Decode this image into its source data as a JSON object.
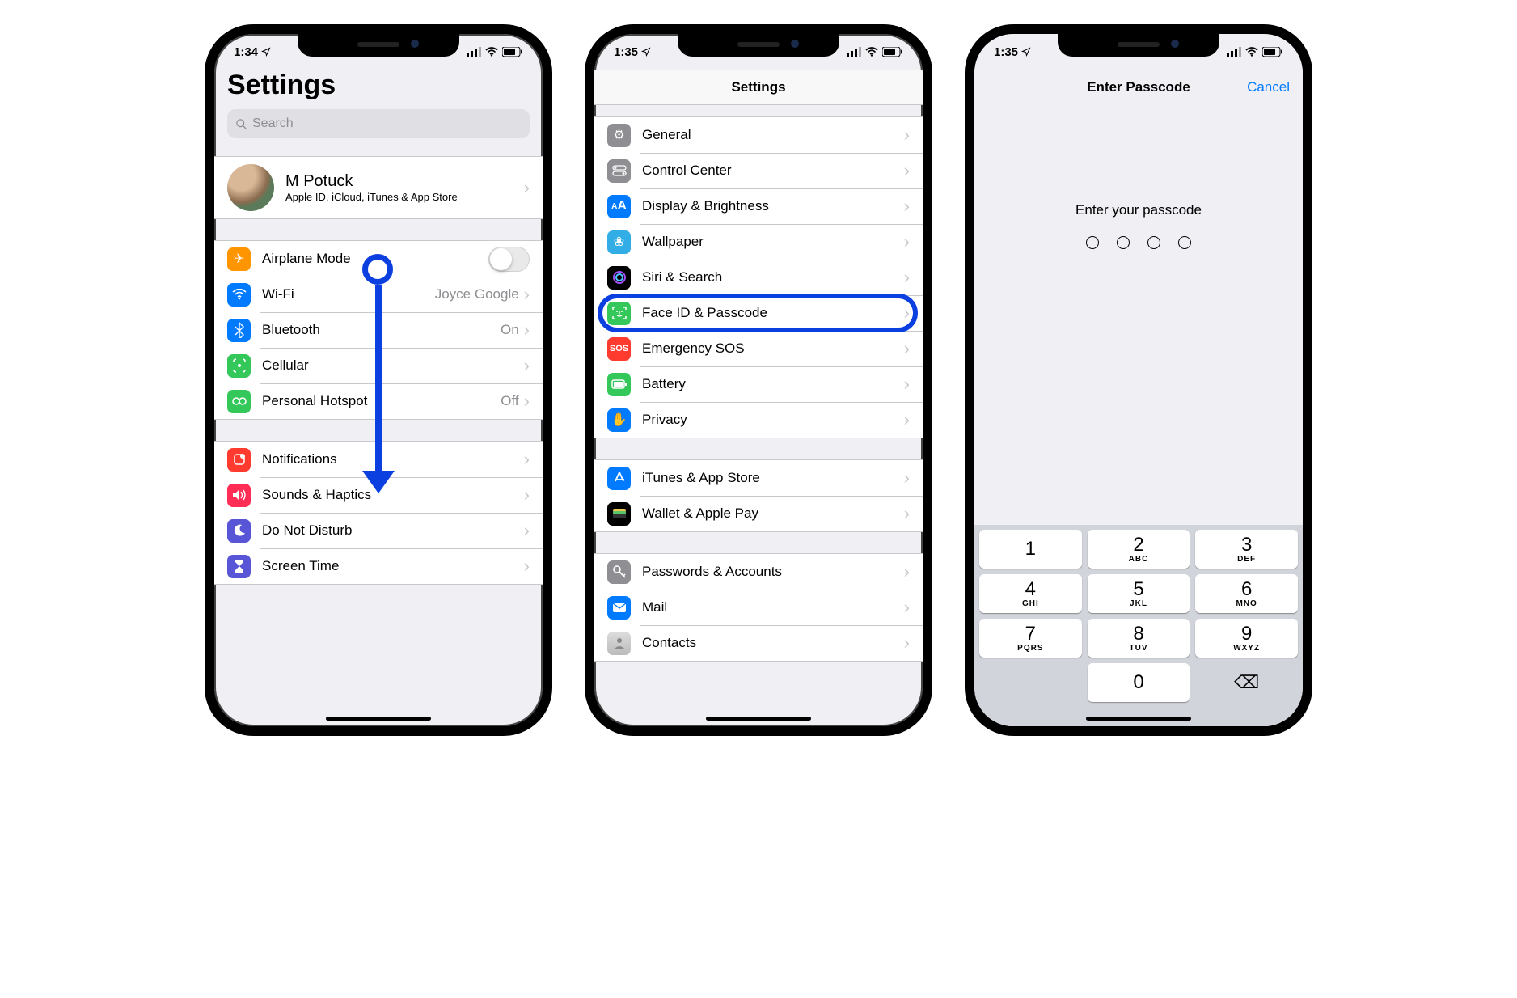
{
  "status": {
    "time1": "1:34",
    "time2": "1:35",
    "time3": "1:35"
  },
  "p1": {
    "title": "Settings",
    "search_placeholder": "Search",
    "profile": {
      "name": "M Potuck",
      "sub": "Apple ID, iCloud, iTunes & App Store"
    },
    "g1": [
      {
        "label": "Airplane Mode",
        "value": "",
        "type": "switch"
      },
      {
        "label": "Wi-Fi",
        "value": "Joyce Google",
        "type": "nav"
      },
      {
        "label": "Bluetooth",
        "value": "On",
        "type": "nav"
      },
      {
        "label": "Cellular",
        "value": "",
        "type": "nav"
      },
      {
        "label": "Personal Hotspot",
        "value": "Off",
        "type": "nav"
      }
    ],
    "g2": [
      {
        "label": "Notifications"
      },
      {
        "label": "Sounds & Haptics"
      },
      {
        "label": "Do Not Disturb"
      },
      {
        "label": "Screen Time"
      }
    ]
  },
  "p2": {
    "nav_title": "Settings",
    "g1": [
      {
        "label": "General"
      },
      {
        "label": "Control Center"
      },
      {
        "label": "Display & Brightness"
      },
      {
        "label": "Wallpaper"
      },
      {
        "label": "Siri & Search"
      },
      {
        "label": "Face ID & Passcode",
        "hl": true
      },
      {
        "label": "Emergency SOS"
      },
      {
        "label": "Battery"
      },
      {
        "label": "Privacy"
      }
    ],
    "g2": [
      {
        "label": "iTunes & App Store"
      },
      {
        "label": "Wallet & Apple Pay"
      }
    ],
    "g3": [
      {
        "label": "Passwords & Accounts"
      },
      {
        "label": "Mail"
      },
      {
        "label": "Contacts"
      }
    ]
  },
  "p3": {
    "nav_title": "Enter Passcode",
    "cancel": "Cancel",
    "prompt": "Enter your passcode",
    "keys": [
      {
        "n": "1",
        "l": ""
      },
      {
        "n": "2",
        "l": "ABC"
      },
      {
        "n": "3",
        "l": "DEF"
      },
      {
        "n": "4",
        "l": "GHI"
      },
      {
        "n": "5",
        "l": "JKL"
      },
      {
        "n": "6",
        "l": "MNO"
      },
      {
        "n": "7",
        "l": "PQRS"
      },
      {
        "n": "8",
        "l": "TUV"
      },
      {
        "n": "9",
        "l": "WXYZ"
      },
      {
        "n": "",
        "l": "",
        "blank": true
      },
      {
        "n": "0",
        "l": ""
      },
      {
        "n": "⌫",
        "l": "",
        "del": true
      }
    ]
  }
}
